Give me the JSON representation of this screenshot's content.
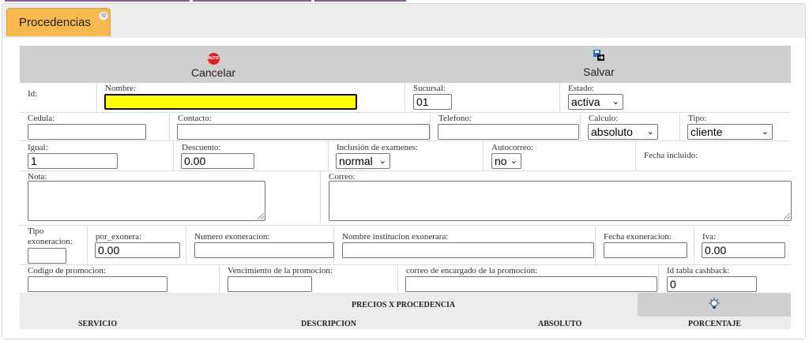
{
  "tab": {
    "title": "Procedencias",
    "close_glyph": "⊗"
  },
  "toolbar": {
    "cancel_label": "Cancelar",
    "cancel_icon_text": "ALTO",
    "save_label": "Salvar"
  },
  "form": {
    "id_label": "Id:",
    "nombre_label": "Nombre:",
    "nombre_value": "",
    "sucursal_label": "Sucursal:",
    "sucursal_value": "01",
    "estado_label": "Estado:",
    "estado_value": "activa",
    "cedula_label": "Cedula:",
    "cedula_value": "",
    "contacto_label": "Contacto:",
    "contacto_value": "",
    "telefono_label": "Telefono:",
    "telefono_value": "",
    "calculo_label": "Calculo:",
    "calculo_value": "absoluto",
    "tipo_label": "Tipo:",
    "tipo_value": "cliente",
    "igual_label": "Igual:",
    "igual_value": "1",
    "descuento_label": "Descuento:",
    "descuento_value": "0.00",
    "inclusion_label": "Inclusión de examenes:",
    "inclusion_value": "normal",
    "autocorreo_label": "Autocorreo:",
    "autocorreo_value": "no",
    "fecha_incluido_label": "Fecha incluido:",
    "nota_label": "Nota:",
    "correo_label": "Correo:",
    "tipo_exoneracion_label_1": "Tipo",
    "tipo_exoneracion_label_2": "exoneracion:",
    "por_exonera_label": "por_exonera:",
    "por_exonera_value": "0.00",
    "numero_exoneracion_label": "Numero exoneracion:",
    "nombre_institucion_label": "Nombre institucion exonerara:",
    "fecha_exoneracion_label": "Fecha exoneracion:",
    "iva_label": "Iva:",
    "iva_value": "0.00",
    "codigo_promocion_label": "Codigo de promocion:",
    "vencimiento_label": "Vencimiento de la promocion:",
    "correo_encargado_label": "correo de encargado de la promocion:",
    "id_cashback_label": "Id tabla cashback:",
    "id_cashback_value": "0"
  },
  "section": {
    "title": "PRECIOS X PROCEDENCIA",
    "columns": [
      "SERVICIO",
      "DESCRIPCION",
      "ABSOLUTO",
      "PORCENTAJE"
    ]
  },
  "chevron": "⌄",
  "colors": {
    "tab": "#f7b850",
    "toolbar": "#cfcfcf",
    "highlight": "#ffff00",
    "stop": "#e21e1e"
  }
}
